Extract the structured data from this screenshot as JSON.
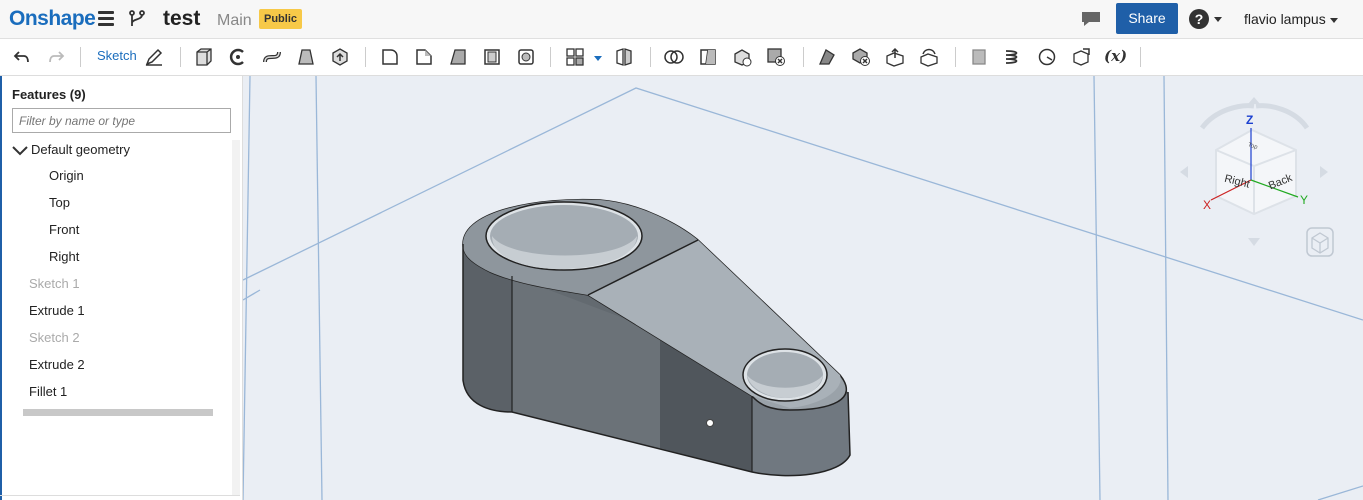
{
  "header": {
    "logo": "Onshape",
    "doc_title": "test",
    "workspace": "Main",
    "visibility_badge": "Public",
    "share_label": "Share",
    "help_label": "?",
    "user_name": "flavio lampus"
  },
  "toolbar": {
    "sketch_label": "Sketch",
    "variables_label": "(x)"
  },
  "features": {
    "title": "Features (9)",
    "filter_placeholder": "Filter by name or type",
    "default_geometry_label": "Default geometry",
    "default_items": [
      "Origin",
      "Top",
      "Front",
      "Right"
    ],
    "items": [
      {
        "label": "Sketch 1",
        "state": "hidden"
      },
      {
        "label": "Extrude 1",
        "state": "active"
      },
      {
        "label": "Sketch 2",
        "state": "hidden"
      },
      {
        "label": "Extrude 2",
        "state": "active"
      },
      {
        "label": "Fillet 1",
        "state": "active"
      }
    ]
  },
  "view_cube": {
    "faces": [
      "Right",
      "Back",
      "Top"
    ],
    "axes": [
      "X",
      "Y",
      "Z"
    ],
    "axis_colors": {
      "X": "#cc2222",
      "Y": "#22aa22",
      "Z": "#1a3fd0"
    }
  },
  "colors": {
    "brand": "#1a6dbd",
    "share_button": "#1f5fa8",
    "badge": "#f7c948",
    "viewport_bg": "#eaeef4",
    "part_gray": "#6b7176"
  }
}
